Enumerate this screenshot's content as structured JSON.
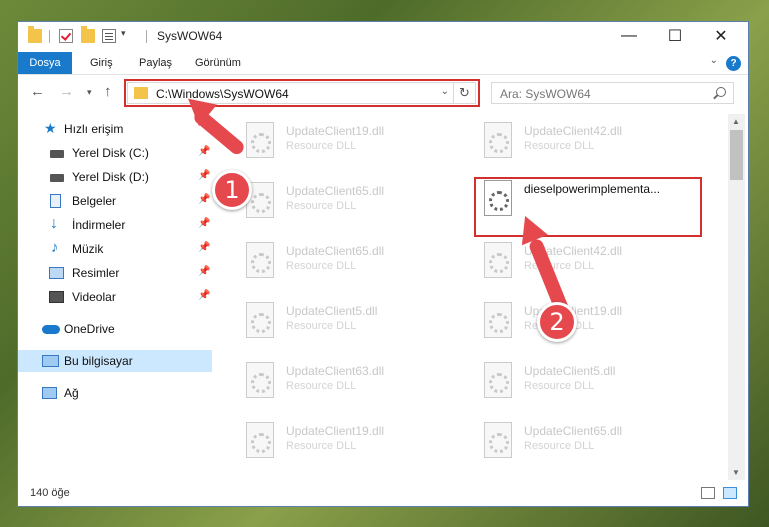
{
  "window": {
    "title": "SysWOW64",
    "controls": {
      "minimize": "—",
      "maximize": "☐",
      "close": "✕"
    }
  },
  "ribbon": {
    "tabs": [
      "Dosya",
      "Giriş",
      "Paylaş",
      "Görünüm"
    ],
    "help": "?"
  },
  "nav": {
    "address": "C:\\Windows\\SysWOW64",
    "search_placeholder": "Ara: SysWOW64"
  },
  "sidebar": {
    "items": [
      {
        "label": "Hızlı erişim",
        "icon": "star-icon"
      },
      {
        "label": "Yerel Disk (C:)",
        "icon": "drive-icon",
        "pinned": true
      },
      {
        "label": "Yerel Disk (D:)",
        "icon": "drive-icon",
        "pinned": true
      },
      {
        "label": "Belgeler",
        "icon": "documents-icon",
        "pinned": true
      },
      {
        "label": "İndirmeler",
        "icon": "download-icon",
        "pinned": true
      },
      {
        "label": "Müzik",
        "icon": "music-icon",
        "pinned": true
      },
      {
        "label": "Resimler",
        "icon": "pictures-icon",
        "pinned": true
      },
      {
        "label": "Videolar",
        "icon": "video-icon",
        "pinned": true
      },
      {
        "label": "OneDrive",
        "icon": "cloud-icon"
      },
      {
        "label": "Bu bilgisayar",
        "icon": "computer-icon",
        "selected": true
      },
      {
        "label": "Ağ",
        "icon": "network-icon"
      }
    ]
  },
  "files": [
    {
      "name": "UpdateClient19.dll",
      "type": "Resource DLL"
    },
    {
      "name": "UpdateClient42.dll",
      "type": "Resource DLL"
    },
    {
      "name": "UpdateClient65.dll",
      "type": "Resource DLL"
    },
    {
      "name": "dieselpowerimplementa...",
      "type": "",
      "highlighted": true
    },
    {
      "name": "UpdateClient65.dll",
      "type": "Resource DLL"
    },
    {
      "name": "UpdateClient42.dll",
      "type": "Resource DLL"
    },
    {
      "name": "UpdateClient5.dll",
      "type": "Resource DLL"
    },
    {
      "name": "UpdateClient19.dll",
      "type": "Resource DLL"
    },
    {
      "name": "UpdateClient63.dll",
      "type": "Resource DLL"
    },
    {
      "name": "UpdateClient5.dll",
      "type": "Resource DLL"
    },
    {
      "name": "UpdateClient19.dll",
      "type": "Resource DLL"
    },
    {
      "name": "UpdateClient65.dll",
      "type": "Resource DLL"
    }
  ],
  "status": {
    "count": "140 öğe"
  },
  "annotations": {
    "badge1": "1",
    "badge2": "2",
    "color": "#e5484d",
    "box_color": "#d32f2f"
  }
}
